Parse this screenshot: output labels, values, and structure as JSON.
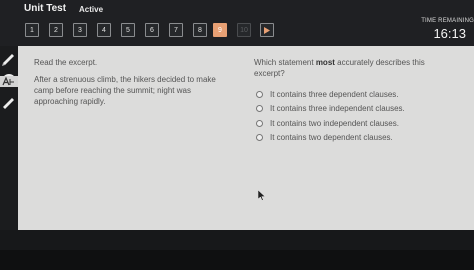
{
  "header": {
    "title": "Unit Test",
    "status": "Active",
    "timer_label": "TIME REMAINING",
    "timer_value": "16:13"
  },
  "question_nav": {
    "items": [
      "1",
      "2",
      "3",
      "4",
      "5",
      "6",
      "7",
      "8",
      "9",
      "10"
    ],
    "current": "9",
    "next_icon": "play-arrow-icon"
  },
  "sidebar": {
    "tools": [
      "pencil-icon",
      "headphones-icon",
      "text-size-icon",
      "pencil-icon"
    ]
  },
  "passage": {
    "label": "Read the excerpt.",
    "text": "After a strenuous climb, the hikers decided to make camp before reaching the summit; night was approaching rapidly."
  },
  "question": {
    "prefix": "Which statement ",
    "emphasis": "most",
    "suffix": " accurately describes this excerpt?",
    "options": [
      "It contains three dependent clauses.",
      "It contains three independent clauses.",
      "It contains two independent clauses.",
      "It contains two dependent clauses."
    ]
  }
}
